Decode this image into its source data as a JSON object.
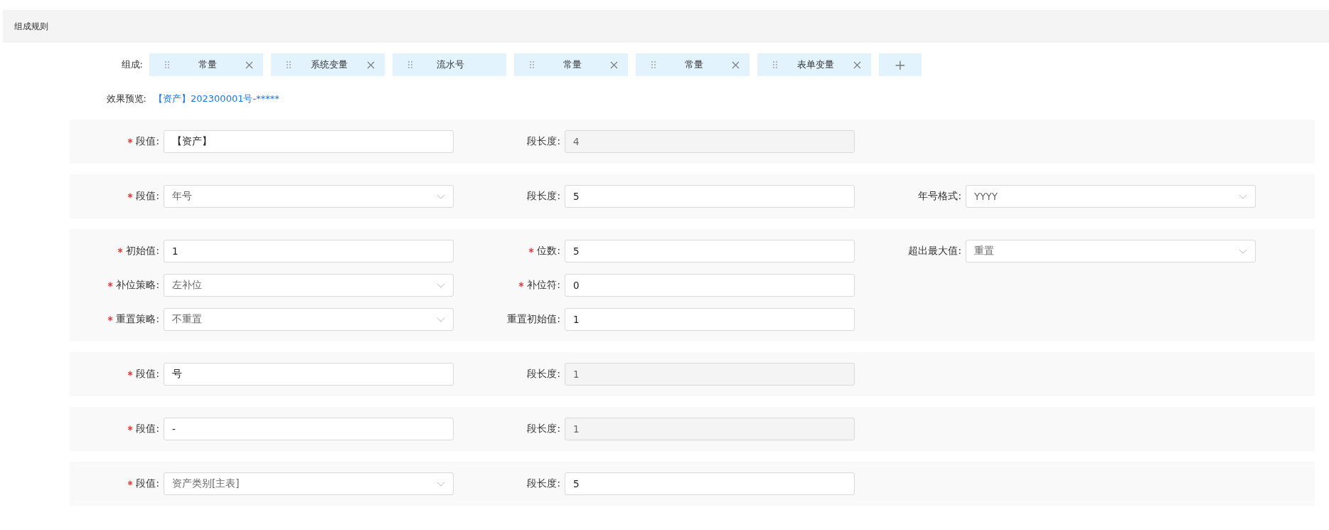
{
  "section": {
    "title": "组成规则"
  },
  "composition": {
    "label": "组成:",
    "chips": [
      {
        "label": "常量",
        "removable": true
      },
      {
        "label": "系统变量",
        "removable": true
      },
      {
        "label": "流水号",
        "removable": false
      },
      {
        "label": "常量",
        "removable": true
      },
      {
        "label": "常量",
        "removable": true
      },
      {
        "label": "表单变量",
        "removable": true
      }
    ],
    "add_button": "+"
  },
  "preview": {
    "label": "效果预览:",
    "value": "【资产】202300001号-*****"
  },
  "segments": [
    {
      "fields": [
        {
          "label": "段值:",
          "required": true,
          "kind": "input",
          "value": "【资产】"
        },
        {
          "label": "段长度:",
          "required": false,
          "kind": "disabled",
          "value": "4"
        }
      ]
    },
    {
      "fields": [
        {
          "label": "段值:",
          "required": true,
          "kind": "select",
          "value": "年号"
        },
        {
          "label": "段长度:",
          "required": false,
          "kind": "input",
          "value": "5"
        },
        {
          "label": "年号格式:",
          "required": false,
          "kind": "select",
          "value": "YYYY"
        }
      ]
    },
    {
      "fields": [
        {
          "label": "初始值:",
          "required": true,
          "kind": "input",
          "value": "1"
        },
        {
          "label": "位数:",
          "required": true,
          "kind": "input",
          "value": "5"
        },
        {
          "label": "超出最大值:",
          "required": false,
          "kind": "select",
          "value": "重置"
        },
        {
          "label": "补位策略:",
          "required": true,
          "kind": "select",
          "value": "左补位"
        },
        {
          "label": "补位符:",
          "required": true,
          "kind": "input",
          "value": "0"
        },
        {
          "kind": "empty"
        },
        {
          "label": "重置策略:",
          "required": true,
          "kind": "select",
          "value": "不重置"
        },
        {
          "label": "重置初始值:",
          "required": false,
          "kind": "input",
          "value": "1"
        }
      ]
    },
    {
      "fields": [
        {
          "label": "段值:",
          "required": true,
          "kind": "input",
          "value": "号"
        },
        {
          "label": "段长度:",
          "required": false,
          "kind": "disabled",
          "value": "1"
        }
      ]
    },
    {
      "fields": [
        {
          "label": "段值:",
          "required": true,
          "kind": "input",
          "value": "-"
        },
        {
          "label": "段长度:",
          "required": false,
          "kind": "disabled",
          "value": "1"
        }
      ]
    },
    {
      "fields": [
        {
          "label": "段值:",
          "required": true,
          "kind": "select",
          "value": "资产类别[主表]"
        },
        {
          "label": "段长度:",
          "required": false,
          "kind": "input",
          "value": "5"
        }
      ]
    }
  ]
}
